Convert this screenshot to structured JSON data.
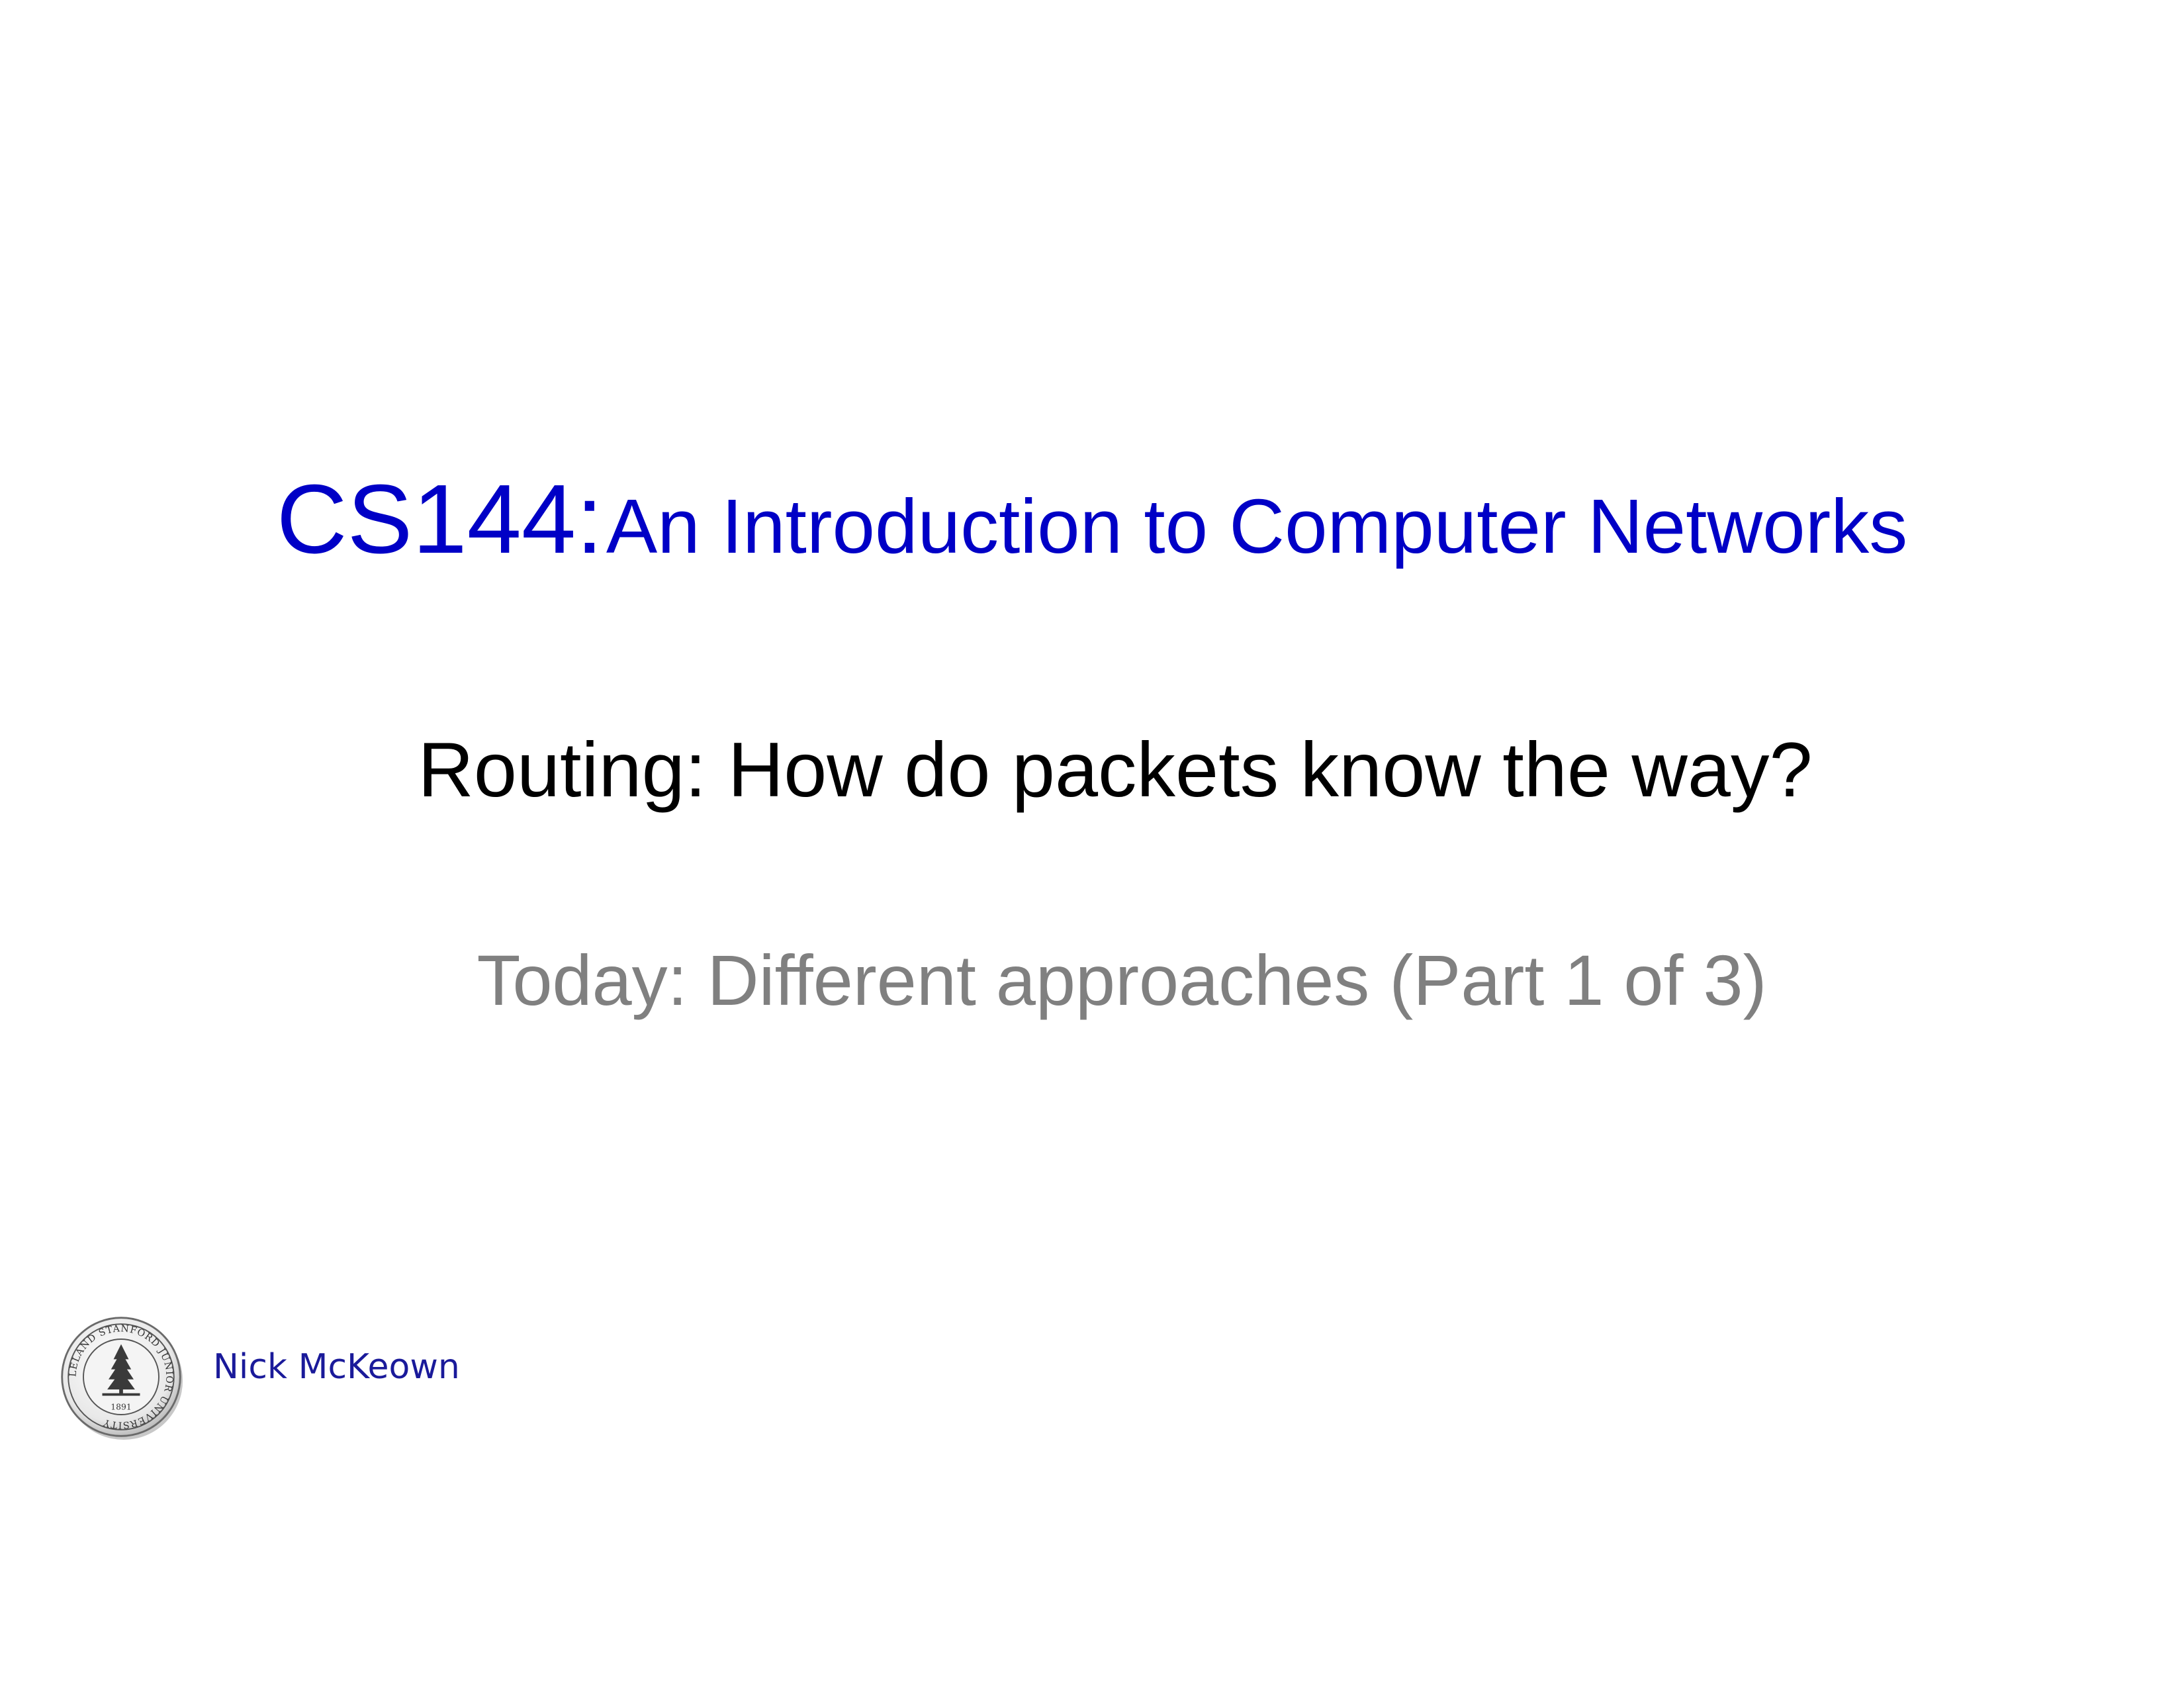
{
  "slide": {
    "course_code": "CS144:",
    "course_name": "An Introduction to Computer Networks",
    "lecture_title": "Routing: How do packets know the way?",
    "lecture_subtitle": "Today: Different approaches (Part 1 of 3)",
    "author": "Nick McKeown",
    "seal": {
      "icon": "stanford-seal-icon",
      "ring_text": "LELAND STANFORD JUNIOR UNIVERSITY",
      "year": "1891"
    }
  },
  "colors": {
    "title_blue": "#0000c6",
    "body_black": "#000000",
    "subtitle_gray": "#808080",
    "author_blue": "#1a1a9a"
  }
}
